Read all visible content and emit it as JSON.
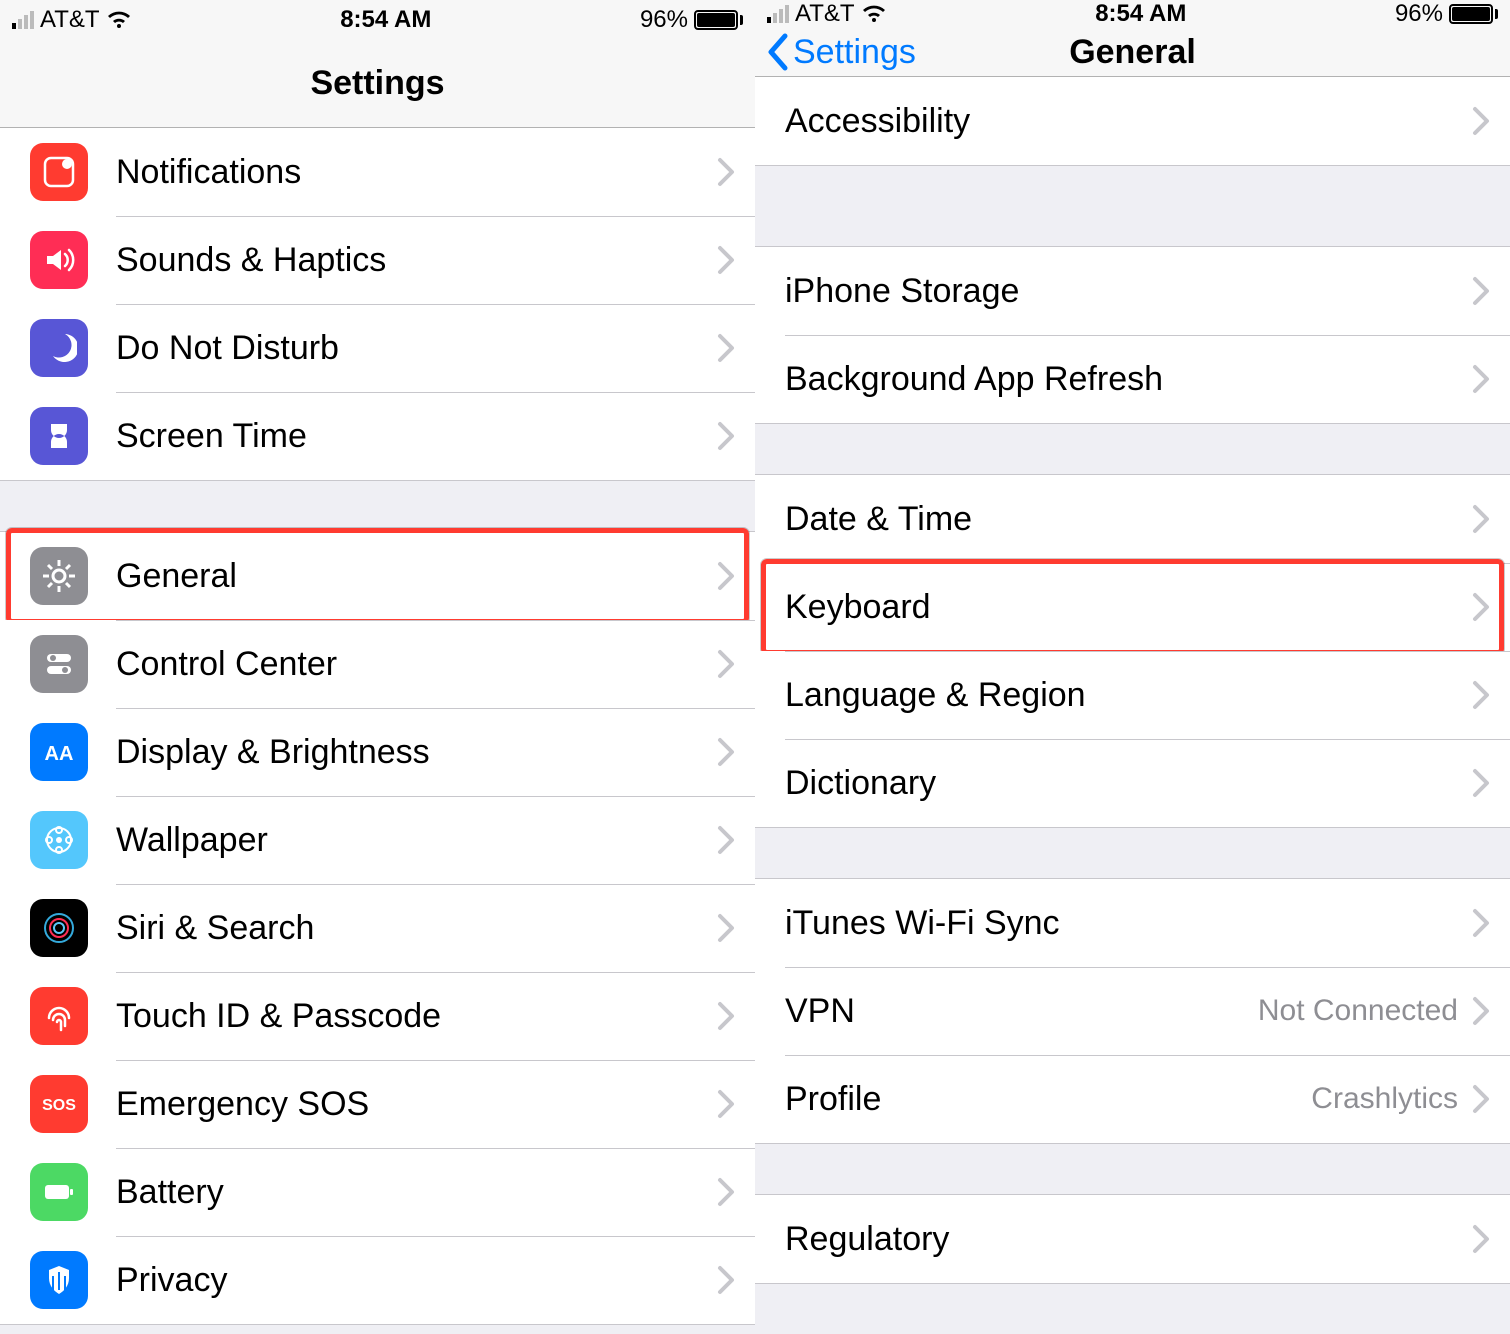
{
  "status": {
    "carrier": "AT&T",
    "time": "8:54 AM",
    "battery_pct": "96%",
    "battery_fill_pct": 96
  },
  "left": {
    "title": "Settings",
    "groups": [
      [
        {
          "label": "Notifications",
          "icon_bg": "#ff3b30",
          "icon": "notifications"
        },
        {
          "label": "Sounds & Haptics",
          "icon_bg": "#ff2d55",
          "icon": "sounds"
        },
        {
          "label": "Do Not Disturb",
          "icon_bg": "#5856d6",
          "icon": "dnd"
        },
        {
          "label": "Screen Time",
          "icon_bg": "#5856d6",
          "icon": "screentime"
        }
      ],
      [
        {
          "label": "General",
          "icon_bg": "#8e8e93",
          "icon": "gear",
          "highlighted": true
        },
        {
          "label": "Control Center",
          "icon_bg": "#8e8e93",
          "icon": "controlcenter"
        },
        {
          "label": "Display & Brightness",
          "icon_bg": "#007aff",
          "icon": "display"
        },
        {
          "label": "Wallpaper",
          "icon_bg": "#54c7fc",
          "icon": "wallpaper"
        },
        {
          "label": "Siri & Search",
          "icon_bg": "#000000",
          "icon": "siri"
        },
        {
          "label": "Touch ID & Passcode",
          "icon_bg": "#ff3b30",
          "icon": "touchid"
        },
        {
          "label": "Emergency SOS",
          "icon_bg": "#ff3b30",
          "icon": "sos"
        },
        {
          "label": "Battery",
          "icon_bg": "#4cd964",
          "icon": "battery"
        },
        {
          "label": "Privacy",
          "icon_bg": "#007aff",
          "icon": "privacy"
        }
      ]
    ]
  },
  "right": {
    "back_label": "Settings",
    "title": "General",
    "groups": [
      [
        {
          "label": "Accessibility"
        }
      ],
      [
        {
          "label": "iPhone Storage"
        },
        {
          "label": "Background App Refresh"
        }
      ],
      [
        {
          "label": "Date & Time"
        },
        {
          "label": "Keyboard",
          "highlighted": true
        },
        {
          "label": "Language & Region"
        },
        {
          "label": "Dictionary"
        }
      ],
      [
        {
          "label": "iTunes Wi-Fi Sync"
        },
        {
          "label": "VPN",
          "value": "Not Connected"
        },
        {
          "label": "Profile",
          "value": "Crashlytics"
        }
      ],
      [
        {
          "label": "Regulatory"
        }
      ]
    ]
  }
}
